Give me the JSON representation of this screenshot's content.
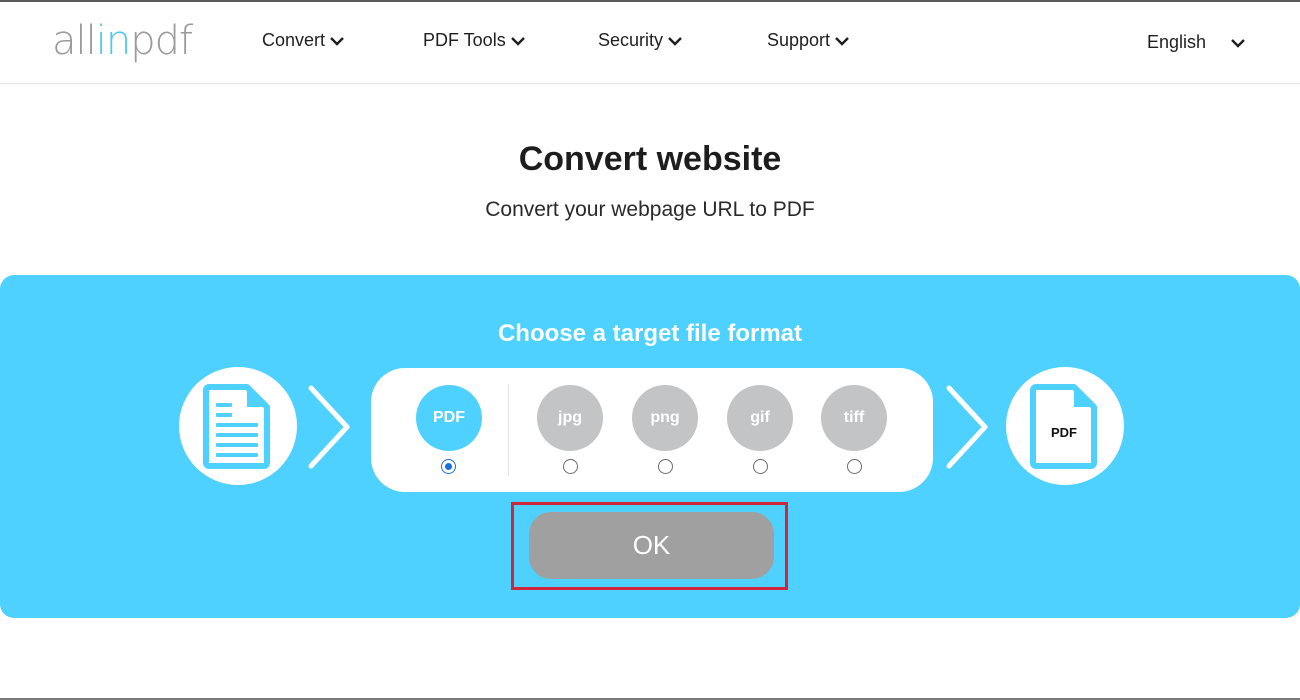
{
  "header": {
    "logo": {
      "part1": "all",
      "part2": "in",
      "part3": "pdf"
    },
    "nav": [
      {
        "label": "Convert"
      },
      {
        "label": "PDF Tools"
      },
      {
        "label": "Security"
      },
      {
        "label": "Support"
      }
    ],
    "language": "English"
  },
  "main": {
    "title": "Convert website",
    "subtitle": "Convert your webpage URL to PDF"
  },
  "converter": {
    "heading": "Choose a target file format",
    "source_icon": "document-icon",
    "target_icon_label": "PDF",
    "formats": [
      {
        "label": "PDF",
        "selected": true
      },
      {
        "label": "jpg",
        "selected": false
      },
      {
        "label": "png",
        "selected": false
      },
      {
        "label": "gif",
        "selected": false
      },
      {
        "label": "tiff",
        "selected": false
      }
    ],
    "ok_label": "OK"
  },
  "colors": {
    "accent": "#4fd1ff",
    "logo_gray": "#9a9a9a",
    "logo_blue": "#4fc9f0",
    "inactive_format": "#c3c4c5",
    "ok_button": "#a0a0a0",
    "highlight": "#d0263a",
    "radio_selected": "#1a6fd8"
  }
}
